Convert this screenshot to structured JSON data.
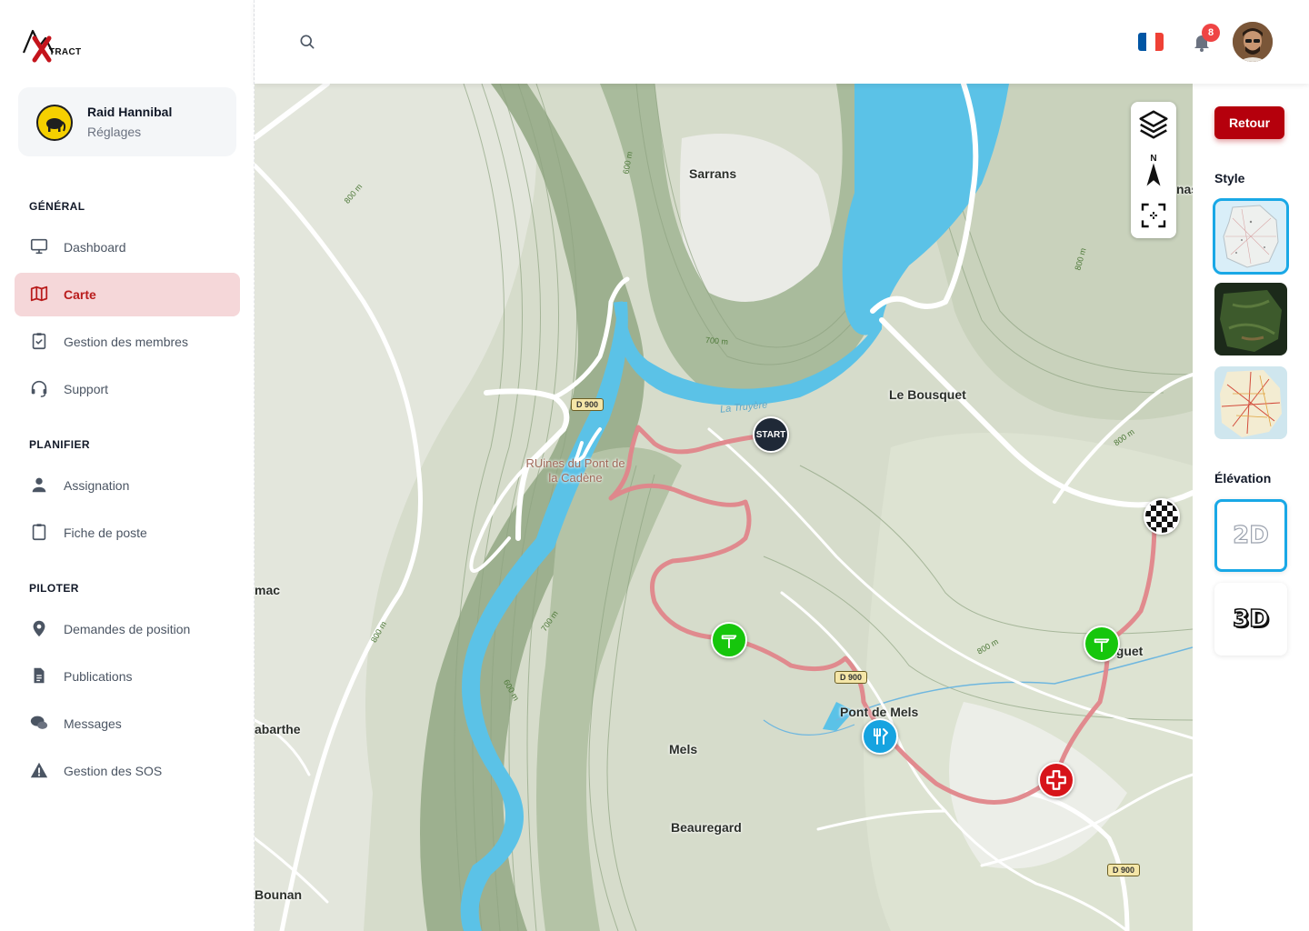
{
  "app": {
    "logo_text": "TRACT",
    "logo_icon": "xtract-logo"
  },
  "org": {
    "name": "Raid Hannibal",
    "subtitle": "Réglages"
  },
  "nav": {
    "sections": [
      {
        "title": "GÉNÉRAL",
        "items": [
          {
            "label": "Dashboard",
            "icon": "monitor-icon"
          },
          {
            "label": "Carte",
            "icon": "map-icon",
            "active": true
          },
          {
            "label": "Gestion des membres",
            "icon": "clipboard-check-icon"
          },
          {
            "label": "Support",
            "icon": "headset-icon"
          }
        ]
      },
      {
        "title": "PLANIFIER",
        "items": [
          {
            "label": "Assignation",
            "icon": "user-icon"
          },
          {
            "label": "Fiche de poste",
            "icon": "clipboard-icon"
          }
        ]
      },
      {
        "title": "PILOTER",
        "items": [
          {
            "label": "Demandes de position",
            "icon": "location-pin-icon"
          },
          {
            "label": "Publications",
            "icon": "document-icon"
          },
          {
            "label": "Messages",
            "icon": "chat-icon"
          },
          {
            "label": "Gestion des SOS",
            "icon": "warning-icon"
          }
        ]
      }
    ]
  },
  "header": {
    "notifications_count": "8",
    "language": "fr",
    "flag_colors": [
      "#0055A4",
      "#FFFFFF",
      "#EF4135"
    ]
  },
  "map": {
    "places": {
      "sarrans": "Sarrans",
      "le_bousquet": "Le Bousquet",
      "ruins": "RUines du Pont de la Cadène",
      "pont_de_mels": "Pont de Mels",
      "mels": "Mels",
      "beauregard": "Beauregard",
      "bounan": "Bounan",
      "labarthe": "abarthe",
      "mac": "mac",
      "aguet": "aguet",
      "nas": "nas"
    },
    "river": "La Truyère",
    "roads": {
      "d900_a": "D 900",
      "d900_b": "D 900",
      "d900_c": "D 900"
    },
    "contours": {
      "c1": "800 m",
      "c2": "600 m",
      "c3": "700 m",
      "c4": "800 m",
      "c5": "800 m",
      "c6": "700 m",
      "c7": "800 m",
      "c8": "600 m",
      "c9": "800 m"
    },
    "markers": {
      "start": "START",
      "checkpoint": "signpost-icon",
      "food": "food-icon",
      "aid": "first-aid-icon",
      "finish": "finish-flag-icon"
    },
    "route_color": "#e0858a",
    "water_color": "#5bc2e7"
  },
  "right_panel": {
    "back_label": "Retour",
    "style_title": "Style",
    "style_options": [
      "plan",
      "satellite",
      "road-map"
    ],
    "style_selected": "plan",
    "elevation_title": "Élévation",
    "elevation_2d": "2D",
    "elevation_3d": "3D",
    "elevation_selected": "2D"
  },
  "colors": {
    "accent": "#b5000c",
    "active_nav_bg": "#f5d7d9",
    "selection": "#19a8e6"
  }
}
